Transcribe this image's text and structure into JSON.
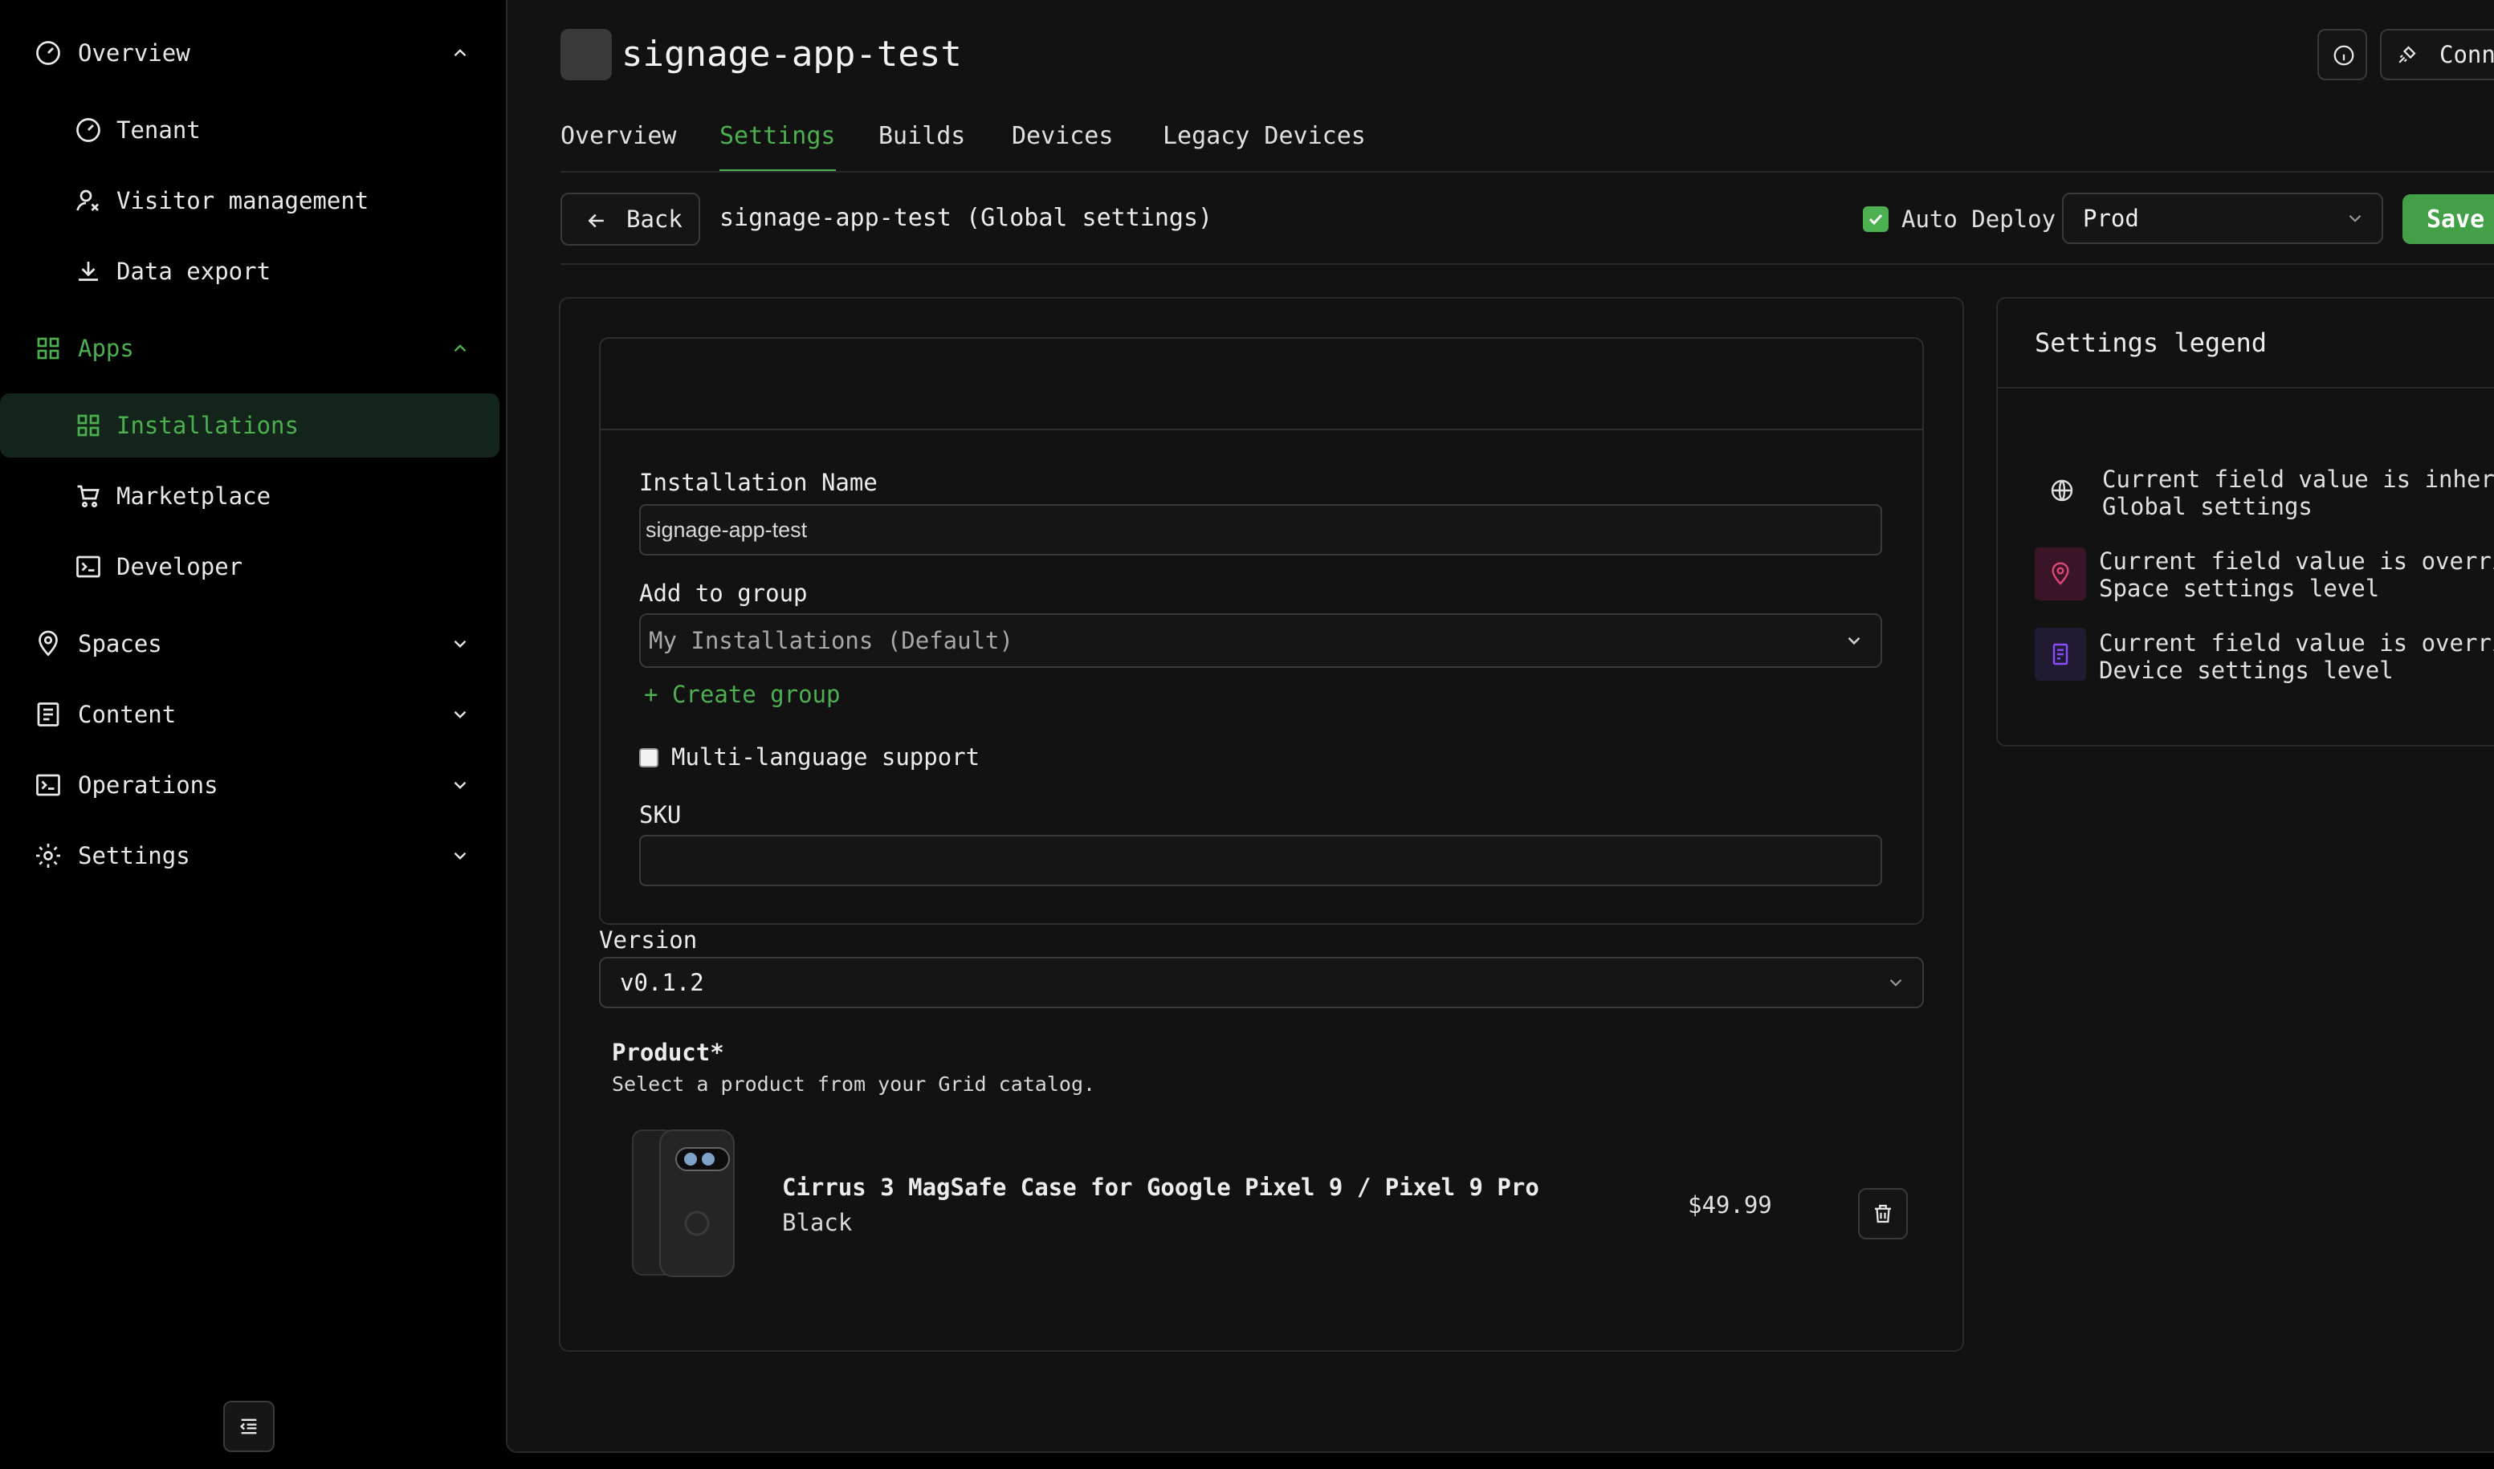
{
  "sidebar": {
    "items": [
      {
        "label": "Overview",
        "icon": "gauge-icon"
      },
      {
        "label": "Tenant",
        "icon": "gauge-icon"
      },
      {
        "label": "Visitor management",
        "icon": "visitor-icon"
      },
      {
        "label": "Data export",
        "icon": "download-icon"
      },
      {
        "label": "Apps",
        "icon": "grid-icon"
      },
      {
        "label": "Installations",
        "icon": "grid-icon"
      },
      {
        "label": "Marketplace",
        "icon": "cart-icon"
      },
      {
        "label": "Developer",
        "icon": "terminal-icon"
      },
      {
        "label": "Spaces",
        "icon": "location-icon"
      },
      {
        "label": "Content",
        "icon": "list-icon"
      },
      {
        "label": "Operations",
        "icon": "terminal-icon"
      },
      {
        "label": "Settings",
        "icon": "gear-icon"
      }
    ]
  },
  "header": {
    "title": "signage-app-test",
    "connect_label": "Conn"
  },
  "tabs": [
    {
      "label": "Overview"
    },
    {
      "label": "Settings"
    },
    {
      "label": "Builds"
    },
    {
      "label": "Devices"
    },
    {
      "label": "Legacy Devices"
    }
  ],
  "toolbar": {
    "back_label": "Back",
    "breadcrumb": "signage-app-test (Global settings)",
    "auto_deploy_label": "Auto Deploy",
    "environment": "Prod",
    "save_label": "Save"
  },
  "form": {
    "installation_name_label": "Installation Name",
    "installation_name_value": "signage-app-test",
    "group_label": "Add to group",
    "group_value": "My Installations (Default)",
    "create_group_label": "Create group",
    "multilanguage_label": "Multi-language support",
    "sku_label": "SKU",
    "sku_value": "",
    "version_label": "Version",
    "version_value": "v0.1.2",
    "product_label": "Product*",
    "product_help": "Select a product from your Grid catalog."
  },
  "product": {
    "name": "Cirrus 3 MagSafe Case for Google Pixel 9 / Pixel 9 Pro",
    "variant": "Black",
    "price": "$49.99"
  },
  "legend": {
    "title": "Settings legend",
    "items": [
      {
        "line1": "Current field value is inheri",
        "line2": "Global settings",
        "color": "#e0e0e0"
      },
      {
        "line1": "Current field value is overri",
        "line2": "Space settings level",
        "color": "#e0457b"
      },
      {
        "line1": "Current field value is overri",
        "line2": "Device settings level",
        "color": "#8a4cff"
      }
    ]
  },
  "colors": {
    "accent": "#4caf50",
    "background": "#121212",
    "sidebar": "#000000"
  }
}
